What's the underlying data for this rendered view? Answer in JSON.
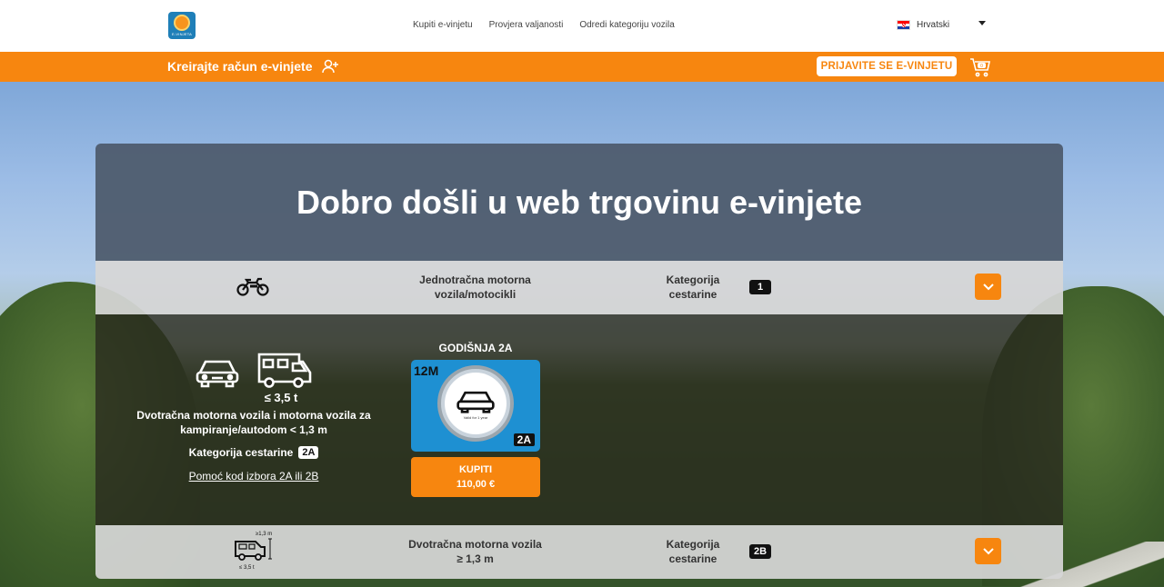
{
  "header": {
    "logo_text": "E-VINJETA",
    "nav": [
      "Kupiti e-vinjetu",
      "Provjera valjanosti",
      "Odredi kategoriju vozila"
    ],
    "language": "Hrvatski"
  },
  "orangebar": {
    "create_account": "Kreirajte račun e-vinjete",
    "login": "PRIJAVITE SE E-VINJETU",
    "cart_count": "0"
  },
  "colors": {
    "accent": "#f7860f",
    "panel_head": "#4e5c6e",
    "vignette_blue": "#1e90d2"
  },
  "panel": {
    "title": "Dobro došli u web trgovinu e-vinjete",
    "rows": [
      {
        "icon": "motorcycle-icon",
        "description": "Jednotračna motorna vozila/motocikli",
        "category_label": "Kategorija cestarine",
        "category": "1"
      },
      {
        "icon": "van-icon",
        "icon_height_label": "≥1,3 m",
        "icon_weight_label": "≤ 3,5 t",
        "description": "Dvotračna motorna vozila ≥ 1,3 m",
        "category_label": "Kategorija cestarine",
        "category": "2B"
      }
    ],
    "detail": {
      "weight": "≤ 3,5 t",
      "description": "Dvotračna motorna vozila i motorna vozila za kampiranje/autodom < 1,3 m",
      "category_label": "Kategorija cestarine",
      "category": "2A",
      "help_link": "Pomoć kod izbora 2A ili 2B",
      "product": {
        "title": "GODIŠNJA 2A",
        "duration": "12M",
        "vignette_sub": "Valid for 1 year",
        "badge": "2A",
        "buy_label": "KUPITI",
        "price": "110,00 €"
      }
    }
  }
}
